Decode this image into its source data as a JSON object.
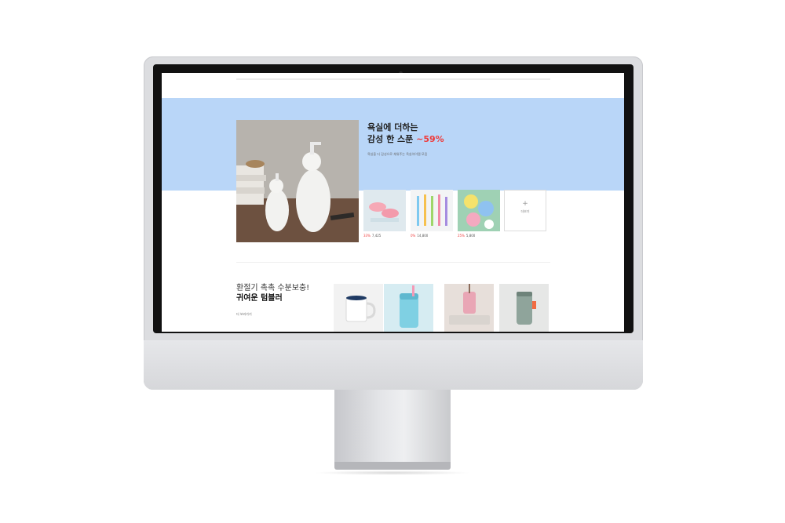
{
  "promo": {
    "title_line1": "욕실에 더하는",
    "title_line2": "감성 한 스푼",
    "discount": "~59%",
    "subtitle": "욕실을 더 감성으로 채워주는 욕실아이템 모음"
  },
  "products": [
    {
      "icon": "slippers-image",
      "discount": "33%",
      "price": "7,425"
    },
    {
      "icon": "toothbrushes-image",
      "discount": "0%",
      "price": "14,800"
    },
    {
      "icon": "coasters-image",
      "discount": "25%",
      "price": "5,800"
    }
  ],
  "more_box": {
    "plus": "+",
    "label": "더보기"
  },
  "tumbler_section": {
    "line1": "환절기 촉촉 수분보충!",
    "line2": "귀여운 텀블러",
    "more_link": "더 보러가기"
  },
  "colors": {
    "banner": "#b9d6f8",
    "discount": "#ee3a3a",
    "bezel": "#dcdde0"
  }
}
